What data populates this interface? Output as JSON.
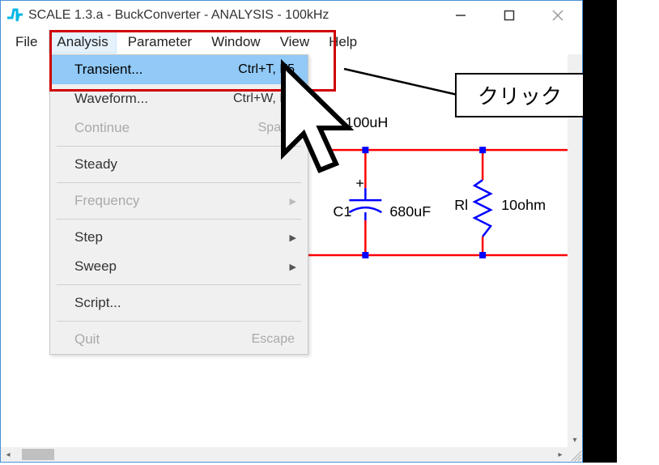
{
  "window": {
    "title": "SCALE 1.3.a - BuckConverter - ANALYSIS - 100kHz"
  },
  "menu": {
    "file": "File",
    "analysis": "Analysis",
    "parameter": "Parameter",
    "window": "Window",
    "view": "View",
    "help": "Help"
  },
  "dropdown": {
    "transient_label": "Transient...",
    "transient_shortcut": "Ctrl+T, F5",
    "waveform_label": "Waveform...",
    "waveform_shortcut": "Ctrl+W, F6",
    "continue_label": "Continue",
    "continue_shortcut": "Space",
    "steady_label": "Steady",
    "frequency_label": "Frequency",
    "step_label": "Step",
    "sweep_label": "Sweep",
    "script_label": "Script...",
    "quit_label": "Quit",
    "quit_shortcut": "Escape"
  },
  "circuit": {
    "l1_value": "100uH",
    "c1_name": "C1",
    "c1_value": "680uF",
    "r1_name": "Rl",
    "r1_value": "10ohm"
  },
  "callout": {
    "text": "クリック"
  }
}
